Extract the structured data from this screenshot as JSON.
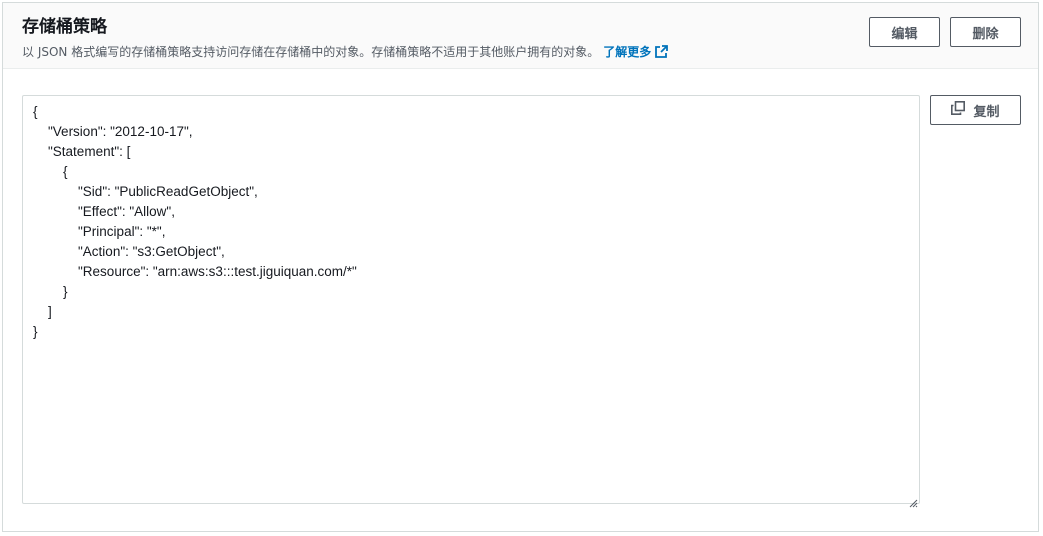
{
  "header": {
    "title": "存储桶策略",
    "description": "以 JSON 格式编写的存储桶策略支持访问存储在存储桶中的对象。存储桶策略不适用于其他账户拥有的对象。",
    "learn_more": "了解更多"
  },
  "actions": {
    "edit_label": "编辑",
    "delete_label": "删除",
    "copy_label": "复制"
  },
  "policy": {
    "text": "{\n    \"Version\": \"2012-10-17\",\n    \"Statement\": [\n        {\n            \"Sid\": \"PublicReadGetObject\",\n            \"Effect\": \"Allow\",\n            \"Principal\": \"*\",\n            \"Action\": \"s3:GetObject\",\n            \"Resource\": \"arn:aws:s3:::test.jiguiquan.com/*\"\n        }\n    ]\n}"
  },
  "icons": {
    "external_link": "external-link-icon",
    "copy": "copy-icon",
    "resize": "resize-handle-icon"
  },
  "colors": {
    "link": "#0073bb",
    "text": "#16191f",
    "muted": "#545b64",
    "border": "#d5dbdb",
    "header_bg": "#fafafa"
  }
}
